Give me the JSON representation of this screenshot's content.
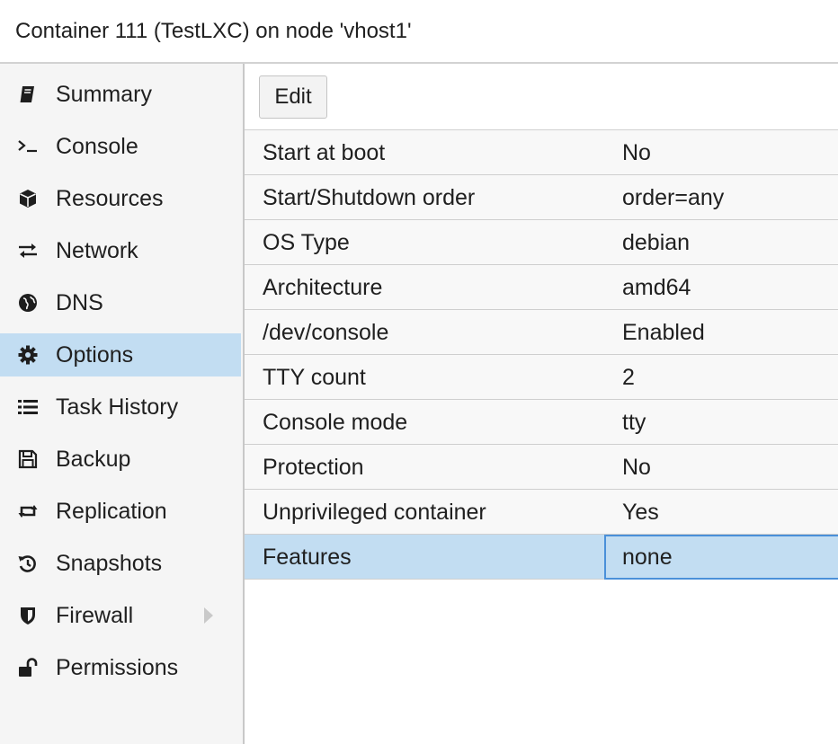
{
  "window": {
    "title": "Container 111 (TestLXC) on node 'vhost1'"
  },
  "sidebar": {
    "items": [
      {
        "label": "Summary",
        "icon": "book-icon",
        "selected": false
      },
      {
        "label": "Console",
        "icon": "terminal-icon",
        "selected": false
      },
      {
        "label": "Resources",
        "icon": "cube-icon",
        "selected": false
      },
      {
        "label": "Network",
        "icon": "exchange-icon",
        "selected": false
      },
      {
        "label": "DNS",
        "icon": "globe-icon",
        "selected": false
      },
      {
        "label": "Options",
        "icon": "gear-icon",
        "selected": true
      },
      {
        "label": "Task History",
        "icon": "list-icon",
        "selected": false
      },
      {
        "label": "Backup",
        "icon": "floppy-icon",
        "selected": false
      },
      {
        "label": "Replication",
        "icon": "retweet-icon",
        "selected": false
      },
      {
        "label": "Snapshots",
        "icon": "history-icon",
        "selected": false
      },
      {
        "label": "Firewall",
        "icon": "shield-icon",
        "selected": false
      },
      {
        "label": "Permissions",
        "icon": "unlock-icon",
        "selected": false
      }
    ]
  },
  "toolbar": {
    "edit_label": "Edit"
  },
  "options": {
    "rows": [
      {
        "key": "Start at boot",
        "value": "No"
      },
      {
        "key": "Start/Shutdown order",
        "value": "order=any"
      },
      {
        "key": "OS Type",
        "value": "debian"
      },
      {
        "key": "Architecture",
        "value": "amd64"
      },
      {
        "key": "/dev/console",
        "value": "Enabled"
      },
      {
        "key": "TTY count",
        "value": "2"
      },
      {
        "key": "Console mode",
        "value": "tty"
      },
      {
        "key": "Protection",
        "value": "No"
      },
      {
        "key": "Unprivileged container",
        "value": "Yes"
      },
      {
        "key": "Features",
        "value": "none"
      }
    ],
    "selected_index": 9
  },
  "colors": {
    "selected": "#c2ddf2",
    "focus_border": "#4a90d9"
  }
}
